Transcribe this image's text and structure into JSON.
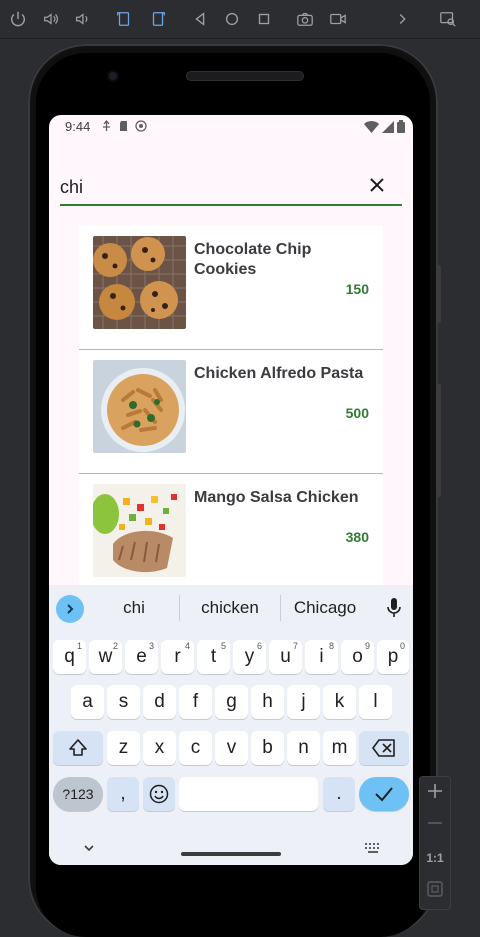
{
  "status_bar": {
    "time": "9:44"
  },
  "search": {
    "value": "chi",
    "placeholder": ""
  },
  "recipes": [
    {
      "title": "Chocolate Chip Cookies",
      "calories": "150",
      "image": "cookies"
    },
    {
      "title": "Chicken Alfredo Pasta",
      "calories": "500",
      "image": "pasta"
    },
    {
      "title": "Mango Salsa Chicken",
      "calories": "380",
      "image": "mango-chicken"
    }
  ],
  "keyboard": {
    "suggestions": [
      "chi",
      "chicken",
      "Chicago"
    ],
    "row1": [
      {
        "k": "q",
        "h": "1"
      },
      {
        "k": "w",
        "h": "2"
      },
      {
        "k": "e",
        "h": "3"
      },
      {
        "k": "r",
        "h": "4"
      },
      {
        "k": "t",
        "h": "5"
      },
      {
        "k": "y",
        "h": "6"
      },
      {
        "k": "u",
        "h": "7"
      },
      {
        "k": "i",
        "h": "8"
      },
      {
        "k": "o",
        "h": "9"
      },
      {
        "k": "p",
        "h": "0"
      }
    ],
    "row2": [
      "a",
      "s",
      "d",
      "f",
      "g",
      "h",
      "j",
      "k",
      "l"
    ],
    "row3": [
      "z",
      "x",
      "c",
      "v",
      "b",
      "n",
      "m"
    ],
    "num_label": "?123",
    "comma": ",",
    "period": "."
  },
  "side_panel": {
    "zoom_label": "1:1"
  },
  "colors": {
    "accent_green": "#2e7d32",
    "keyboard_accent": "#6ec1f5",
    "screen_bg": "#fff7fc"
  }
}
